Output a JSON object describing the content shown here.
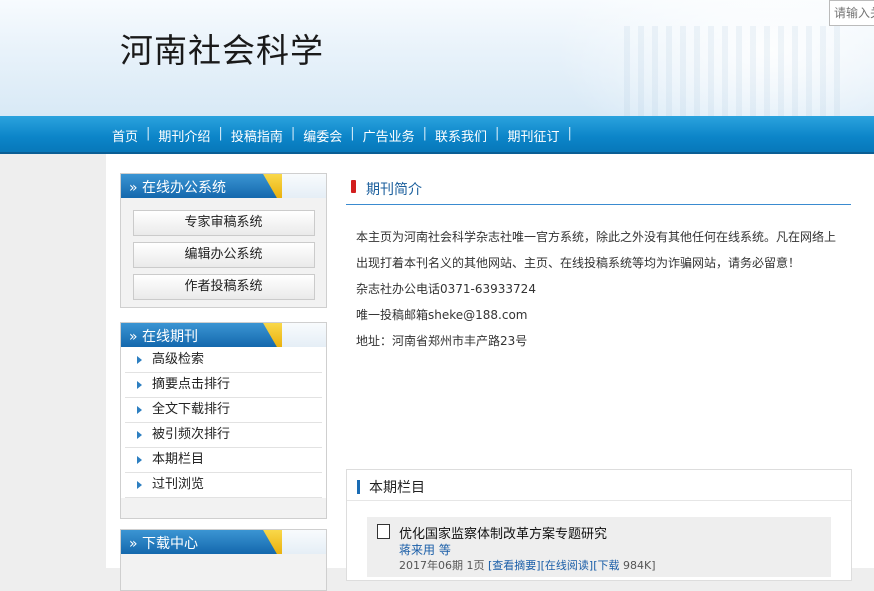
{
  "header": {
    "site_title": "河南社会科学",
    "search_placeholder": "请输入关"
  },
  "nav": {
    "items": [
      "首页",
      "期刊介绍",
      "投稿指南",
      "编委会",
      "广告业务",
      "联系我们",
      "期刊征订"
    ],
    "separator": "|"
  },
  "sidebar": {
    "office": {
      "title": "在线办公系统",
      "buttons": [
        "专家审稿系统",
        "编辑办公系统",
        "作者投稿系统"
      ]
    },
    "journal": {
      "title": "在线期刊",
      "items": [
        "高级检索",
        "摘要点击排行",
        "全文下载排行",
        "被引频次排行",
        "本期栏目",
        "过刊浏览"
      ]
    },
    "download": {
      "title": "下载中心"
    }
  },
  "intro": {
    "title": "期刊简介",
    "paragraphs": [
      "本主页为河南社会科学杂志社唯一官方系统，除此之外没有其他任何在线系统。凡在网络上出现打着本刊名义的其他网站、主页、在线投稿系统等均为诈骗网站，请务必留意！",
      "杂志社办公电话0371-63933724",
      "唯一投稿邮箱sheke@188.com",
      "地址：河南省郑州市丰产路23号"
    ]
  },
  "current_issue": {
    "title": "本期栏目",
    "article": {
      "title": "优化国家监察体制改革方案专题研究",
      "author": "蒋来用 等",
      "meta": "2017年06期 1页",
      "link_abstract": "[查看摘要]",
      "link_read": "[在线阅读]",
      "link_download": "[下载",
      "size": "984K]"
    }
  }
}
